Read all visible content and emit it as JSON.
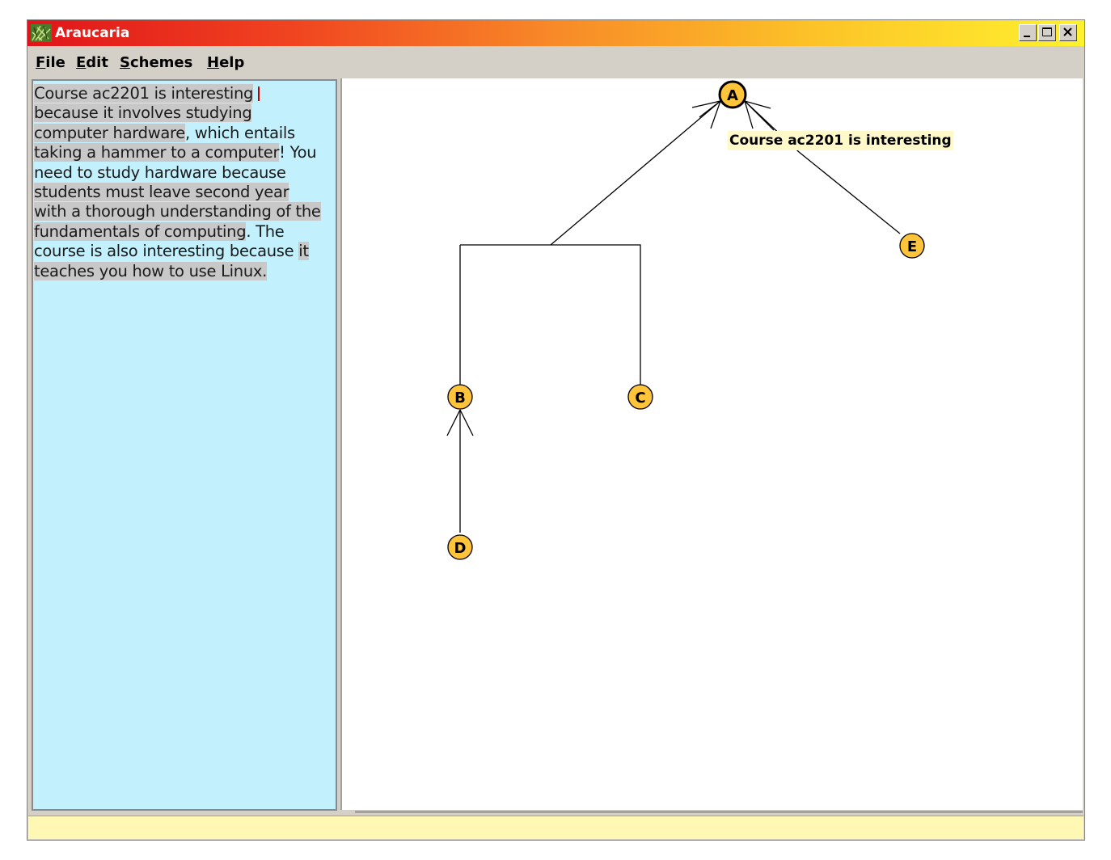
{
  "window": {
    "title": "Araucaria",
    "app_icon": "araucaria-leaf-icon",
    "controls": {
      "minimize": "minimize-icon",
      "maximize": "maximize-icon",
      "close": "close-icon"
    }
  },
  "menu": {
    "file": {
      "mnemonic": "F",
      "rest": "ile"
    },
    "edit": {
      "mnemonic": "E",
      "rest": "dit"
    },
    "schemes": {
      "mnemonic": "S",
      "rest": "chemes"
    },
    "help": {
      "mnemonic": "H",
      "rest": "elp"
    }
  },
  "source_text": {
    "s1": "Course ac2201 is interesting",
    "s2": "because",
    "s3": " it involves studying computer hardware",
    "s4": ", which entails ",
    "s5": "taking a hammer to a computer",
    "s6": "! You need to study hardware because ",
    "s7": "students must leave second year with a thorough understanding of the ",
    "s8": "fundamentals of computing",
    "s9": ". The course is also interesting because ",
    "s10": "it teaches you how to use Linux."
  },
  "diagram": {
    "nodes": [
      {
        "id": "A",
        "label": "A",
        "selected": true
      },
      {
        "id": "B",
        "label": "B"
      },
      {
        "id": "C",
        "label": "C"
      },
      {
        "id": "D",
        "label": "D"
      },
      {
        "id": "E",
        "label": "E"
      }
    ],
    "edges": [
      {
        "from": "B",
        "to": "A",
        "linked_with": "C"
      },
      {
        "from": "C",
        "to": "A",
        "linked_with": "B"
      },
      {
        "from": "D",
        "to": "B"
      },
      {
        "from": "E",
        "to": "A"
      }
    ],
    "tooltip": "Course ac2201 is interesting",
    "node_fill": "#ffc43a",
    "node_stroke": "#000000",
    "highlight_color": "#c8c8c8",
    "text_panel_bg": "#c2f0fc",
    "status_bg": "#fff7b4"
  },
  "status": {
    "text": ""
  }
}
